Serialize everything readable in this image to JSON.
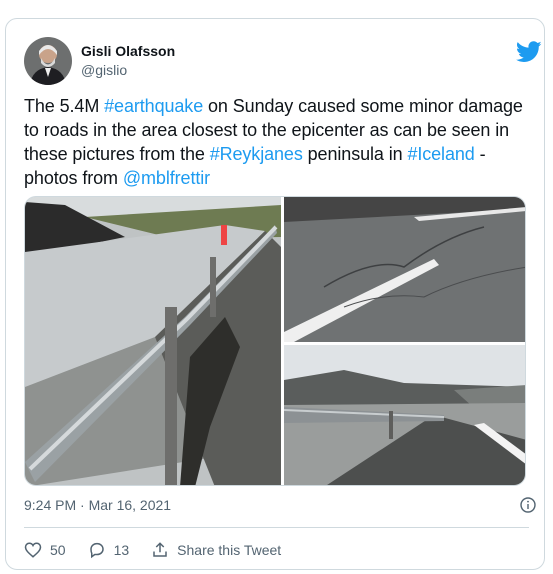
{
  "author": {
    "name": "Gisli Olafsson",
    "handle": "@gislio",
    "avatar_icon": "user-avatar",
    "bird_icon": "twitter-bird-icon",
    "bird_color": "#1d9bf0"
  },
  "tweet": {
    "t1": "The 5.4M ",
    "h1": "#earthquake",
    "t2": " on Sunday caused some minor damage to roads in the area closest to the epicenter as can be seen in these pictures from the ",
    "h2": "#Reykjanes",
    "t3": " peninsula in ",
    "h3": "#Iceland",
    "t4": "  - photos from ",
    "m1": "@mblfrettir",
    "link_color": "#1d9bf0"
  },
  "meta": {
    "timestamp": "9:24 PM · Mar 16, 2021"
  },
  "actions": {
    "likes": "50",
    "replies": "13",
    "share_label": "Share this Tweet"
  }
}
